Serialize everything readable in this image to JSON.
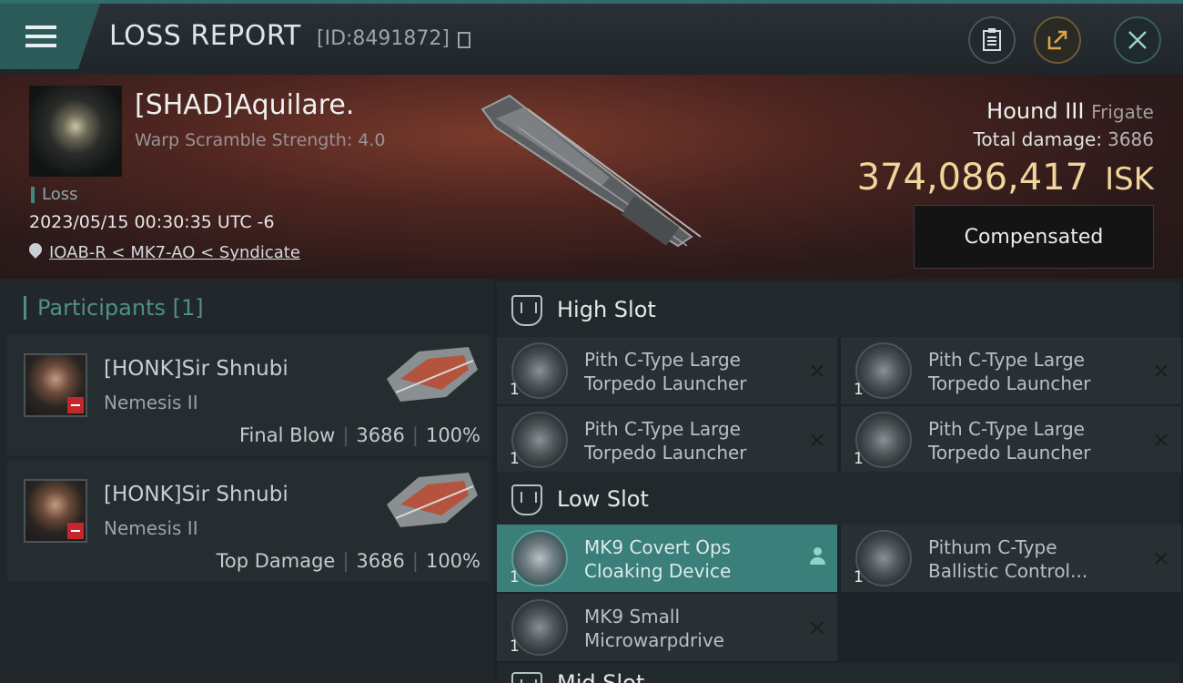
{
  "header": {
    "title": "LOSS REPORT",
    "report_id": "[ID:8491872]"
  },
  "victim": {
    "name": "[SHAD]Aquilare.",
    "warp_scramble": "Warp Scramble Strength: 4.0",
    "result_tag": "Loss",
    "datetime": "2023/05/15 00:30:35 UTC -6",
    "location": "IOAB-R < MK7-AO < Syndicate",
    "ship_name": "Hound III",
    "ship_class": "Frigate",
    "total_damage_label": "Total damage:",
    "total_damage": "3686",
    "isk_value": "374,086,417",
    "isk_unit": "ISK",
    "compensated_label": "Compensated"
  },
  "participants": {
    "label": "Participants",
    "count": "[1]",
    "items": [
      {
        "name": "[HONK]Sir Shnubi",
        "ship": "Nemesis II",
        "role": "Final Blow",
        "damage": "3686",
        "percent": "100%"
      },
      {
        "name": "[HONK]Sir Shnubi",
        "ship": "Nemesis II",
        "role": "Top Damage",
        "damage": "3686",
        "percent": "100%"
      }
    ]
  },
  "slots": {
    "high": {
      "label": "High Slot",
      "modules": [
        {
          "line1": "Pith C-Type Large",
          "line2": "Torpedo Launcher",
          "qty": "1"
        },
        {
          "line1": "Pith C-Type Large",
          "line2": "Torpedo Launcher",
          "qty": "1"
        },
        {
          "line1": "Pith C-Type Large",
          "line2": "Torpedo Launcher",
          "qty": "1"
        },
        {
          "line1": "Pith C-Type Large",
          "line2": "Torpedo Launcher",
          "qty": "1"
        }
      ]
    },
    "low": {
      "label": "Low Slot",
      "modules": [
        {
          "line1": "MK9 Covert Ops",
          "line2": "Cloaking Device",
          "qty": "1",
          "status": "survived"
        },
        {
          "line1": "Pithum C-Type",
          "line2": "Ballistic Control...",
          "qty": "1",
          "status": "destroyed"
        },
        {
          "line1": "MK9 Small",
          "line2": "Microwarpdrive",
          "qty": "1",
          "status": "destroyed"
        }
      ]
    },
    "mid": {
      "label": "Mid Slot"
    }
  },
  "icons": [
    "menu-icon",
    "copy-icon",
    "clipboard-icon",
    "share-icon",
    "close-icon",
    "location-pin-icon",
    "slot-icon",
    "destroyed-x-icon",
    "pilot-icon"
  ],
  "colors": {
    "accent": "#3a7f79",
    "isk_gold": "#f1d59a",
    "loss_red": "#c4262c"
  }
}
